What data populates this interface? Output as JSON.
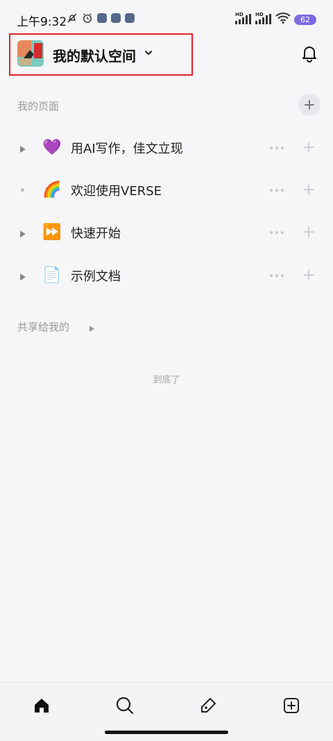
{
  "status_bar": {
    "time": "上午9:32",
    "network_label_1": "HD",
    "network_label_2": "HD",
    "battery": "62"
  },
  "header": {
    "workspace_name": "我的默认空间"
  },
  "my_pages": {
    "title": "我的页面",
    "items": [
      {
        "emoji": "💜",
        "label": "用AI写作，佳文立现",
        "expandable": true
      },
      {
        "emoji": "🌈",
        "label": "欢迎使用VERSE",
        "expandable": false
      },
      {
        "emoji": "⏩",
        "label": "快速开始",
        "expandable": true
      },
      {
        "emoji": "📄",
        "label": "示例文档",
        "expandable": true
      }
    ]
  },
  "shared": {
    "title": "共享给我的"
  },
  "end_note": "到底了",
  "colors": {
    "background": "#f6f6f8",
    "highlight_border": "#e0222b",
    "battery": "#7c6ae6"
  },
  "tabs": [
    {
      "icon": "home-icon"
    },
    {
      "icon": "search-icon"
    },
    {
      "icon": "edit-tag-icon"
    },
    {
      "icon": "add-square-icon"
    }
  ]
}
